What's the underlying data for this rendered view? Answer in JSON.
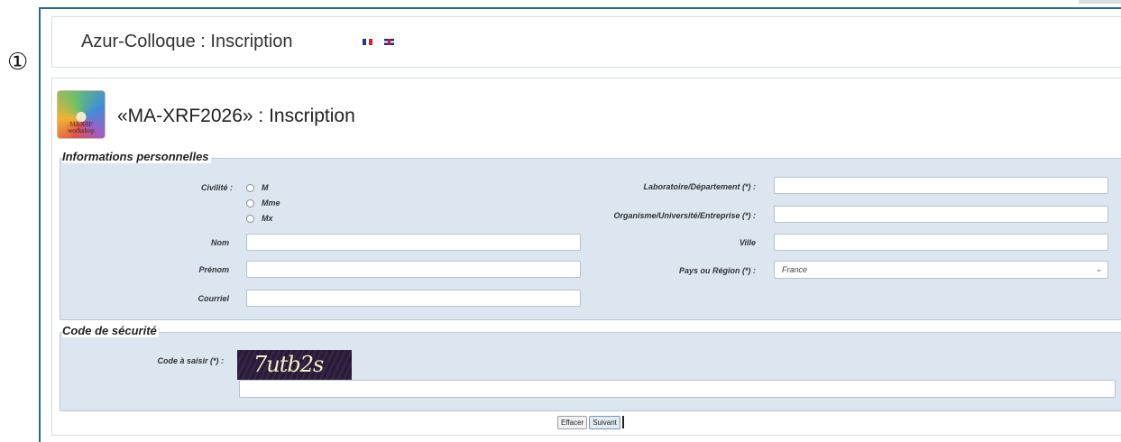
{
  "annotation": {
    "step_marker": "①"
  },
  "header": {
    "title": "Azur-Colloque : Inscription",
    "languages": [
      {
        "code": "fr",
        "icon": "flag-france-icon"
      },
      {
        "code": "en",
        "icon": "flag-uk-icon"
      }
    ]
  },
  "event": {
    "title": "«MA-XRF2026» : Inscription",
    "logo": {
      "icon": "event-logo",
      "text": "MA-XRF workshop"
    }
  },
  "personal_info": {
    "legend": "Informations personnelles",
    "civility": {
      "label": "Civilité :",
      "options": [
        "M",
        "Mme",
        "Mx"
      ],
      "selected": null
    },
    "nom": {
      "label": "Nom",
      "value": ""
    },
    "prenom": {
      "label": "Prénom",
      "value": ""
    },
    "courriel": {
      "label": "Courriel",
      "value": ""
    },
    "laboratoire": {
      "label": "Laboratoire/Département (*) :",
      "value": ""
    },
    "organisme": {
      "label": "Organisme/Université/Entreprise (*) :",
      "value": ""
    },
    "ville": {
      "label": "Ville",
      "value": ""
    },
    "pays": {
      "label": "Pays ou Région (*) :",
      "value": "France"
    }
  },
  "security": {
    "legend": "Code de sécurité",
    "code_label": "Code à saisir (*) :",
    "captcha_text": "7utb2s",
    "code_value": ""
  },
  "actions": {
    "clear_label": "Effacer",
    "next_label": "Suivant"
  },
  "colors": {
    "frame_border": "#2a6a8f",
    "fieldset_bg": "#dbe6f1",
    "fieldset_border": "#b9c9d8"
  }
}
